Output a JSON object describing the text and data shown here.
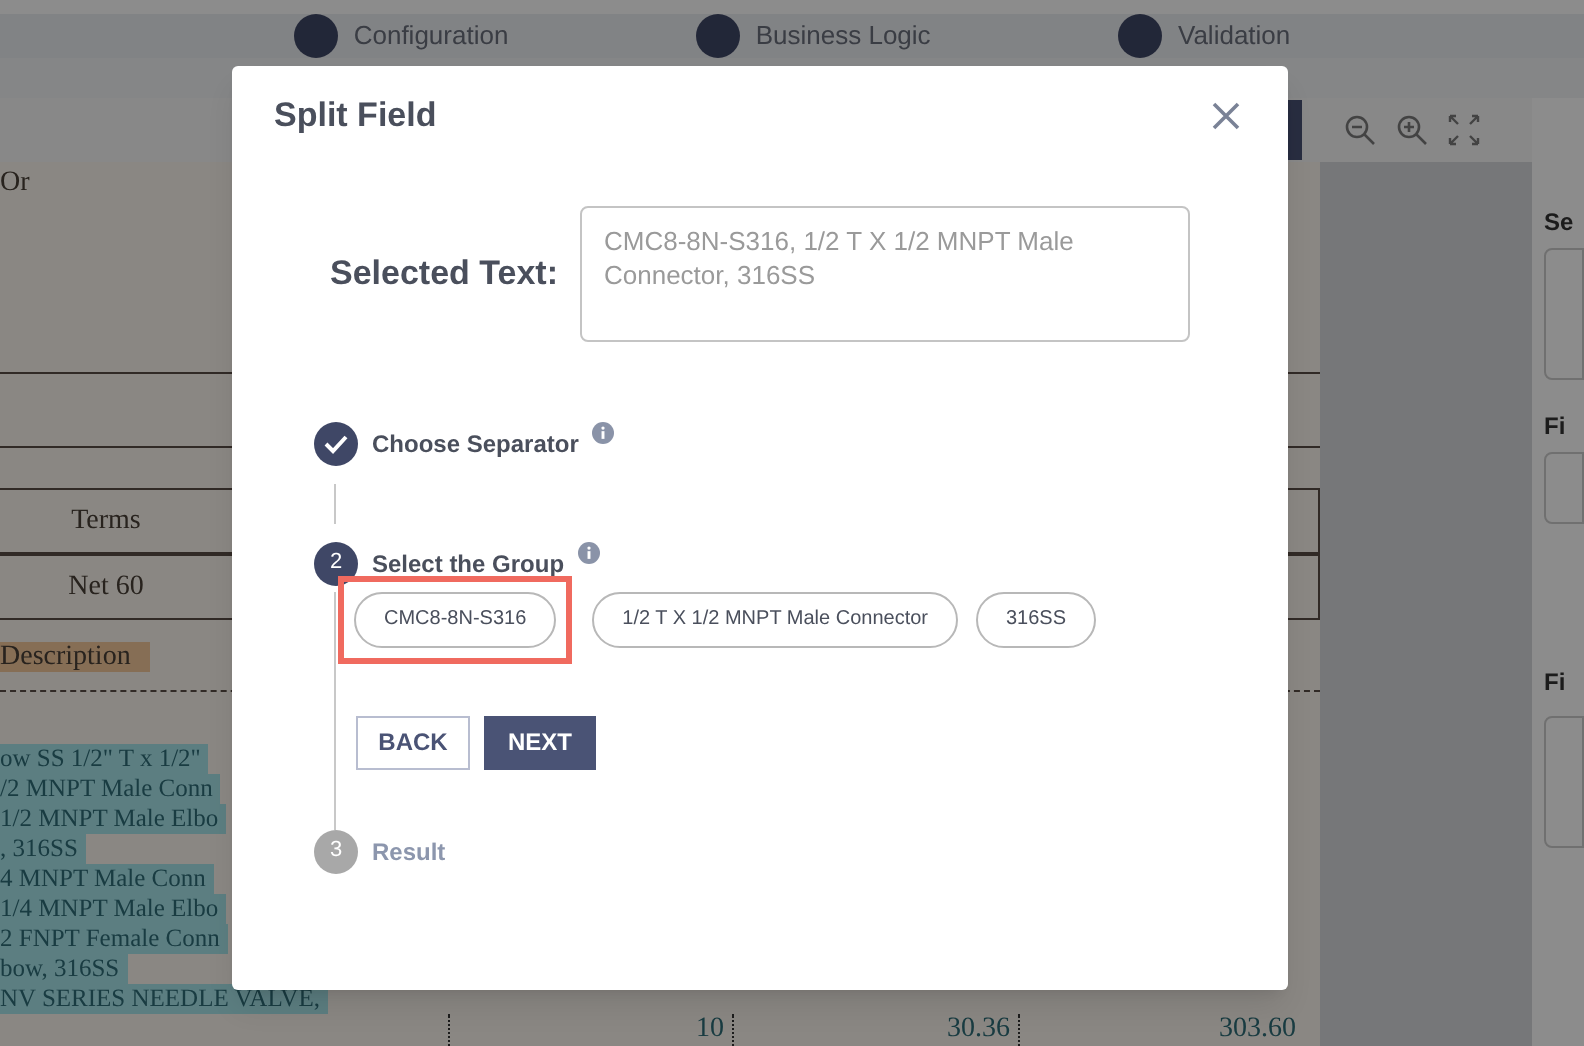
{
  "header_steps": [
    {
      "label": "Configuration"
    },
    {
      "label": "Business Logic"
    },
    {
      "label": "Validation"
    }
  ],
  "document": {
    "intro": "Or",
    "table_rows": [
      {
        "text": "Terms"
      },
      {
        "text": "Net 60"
      }
    ],
    "description_heading": "Description",
    "item_lines": [
      {
        "text": "ow SS 1/2\" T x 1/2\""
      },
      {
        "text": "/2 MNPT Male Conn"
      },
      {
        "text": "1/2 MNPT Male Elbo"
      },
      {
        "text": ", 316SS"
      },
      {
        "text": "4 MNPT Male Conn"
      },
      {
        "text": "1/4 MNPT Male Elbo"
      },
      {
        "text": "2 FNPT Female Conn"
      },
      {
        "text": "bow, 316SS"
      },
      {
        "text": "NV SERIES NEEDLE VALVE,"
      }
    ],
    "last_row": [
      "10",
      "30.36",
      "303.60"
    ]
  },
  "right_panel": {
    "labels": [
      "Se",
      "Fi",
      "Fi"
    ]
  },
  "dialog": {
    "title": "Split Field",
    "selected_text_label": "Selected Text:",
    "selected_text": "CMC8-8N-S316, 1/2 T X 1/2 MNPT Male Connector, 316SS",
    "steps": [
      {
        "kind": "done",
        "label": "Choose Separator",
        "info": true
      },
      {
        "kind": "active",
        "number": "2",
        "label": "Select the Group",
        "info": true
      },
      {
        "kind": "pending",
        "number": "3",
        "label": "Result",
        "info": false
      }
    ],
    "groups": [
      {
        "label": "CMC8-8N-S316",
        "selected": true
      },
      {
        "label": "1/2 T X 1/2 MNPT Male Connector",
        "selected": false
      },
      {
        "label": "316SS",
        "selected": false
      }
    ],
    "back_button": "BACK",
    "next_button": "NEXT"
  }
}
